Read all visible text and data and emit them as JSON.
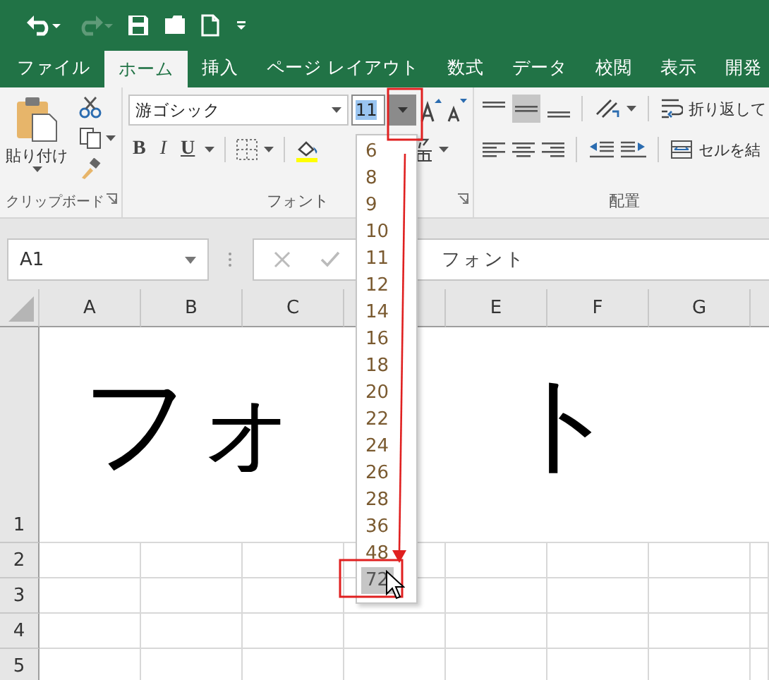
{
  "quick_access": [
    {
      "kind": "undo",
      "disabled": false
    },
    {
      "kind": "redo",
      "disabled": true
    },
    {
      "kind": "save",
      "disabled": false
    },
    {
      "kind": "open",
      "disabled": false
    },
    {
      "kind": "new",
      "disabled": false
    },
    {
      "kind": "customize",
      "disabled": false
    }
  ],
  "tabs": [
    {
      "label": "ファイル",
      "selected": false
    },
    {
      "label": "ホーム",
      "selected": true
    },
    {
      "label": "挿入",
      "selected": false
    },
    {
      "label": "ページ レイアウト",
      "selected": false
    },
    {
      "label": "数式",
      "selected": false
    },
    {
      "label": "データ",
      "selected": false
    },
    {
      "label": "校閲",
      "selected": false
    },
    {
      "label": "表示",
      "selected": false
    },
    {
      "label": "開発",
      "selected": false
    }
  ],
  "ribbon": {
    "clipboard": {
      "paste_label": "貼り付け",
      "group_label": "クリップボード"
    },
    "font": {
      "font_name": "游ゴシック",
      "font_size": "11",
      "style_buttons": [
        "B",
        "I",
        "U"
      ],
      "group_label": "フォント"
    },
    "alignment": {
      "wrap_label": "折り返して",
      "merge_label": "セルを結",
      "group_label": "配置"
    }
  },
  "formula_bar": {
    "name_box": "A1",
    "formula": "フォント"
  },
  "columns": [
    {
      "label": "A"
    },
    {
      "label": "B"
    },
    {
      "label": "C"
    },
    {},
    {
      "label": "E"
    },
    {
      "label": "F"
    },
    {
      "label": "G"
    }
  ],
  "rows": [
    "1",
    "2",
    "3",
    "4",
    "5"
  ],
  "cell_a1": {
    "visible_parts": [
      "フォ",
      "ト"
    ]
  },
  "font_size_list": [
    {
      "label": "6",
      "selected": false
    },
    {
      "label": "8",
      "selected": false
    },
    {
      "label": "9",
      "selected": false
    },
    {
      "label": "10",
      "selected": false
    },
    {
      "label": "11",
      "selected": false
    },
    {
      "label": "12",
      "selected": false
    },
    {
      "label": "14",
      "selected": false
    },
    {
      "label": "16",
      "selected": false
    },
    {
      "label": "18",
      "selected": false
    },
    {
      "label": "20",
      "selected": false
    },
    {
      "label": "22",
      "selected": false
    },
    {
      "label": "24",
      "selected": false
    },
    {
      "label": "26",
      "selected": false
    },
    {
      "label": "28",
      "selected": false
    },
    {
      "label": "36",
      "selected": false
    },
    {
      "label": "48",
      "selected": false
    },
    {
      "label": "72",
      "selected": true
    }
  ]
}
